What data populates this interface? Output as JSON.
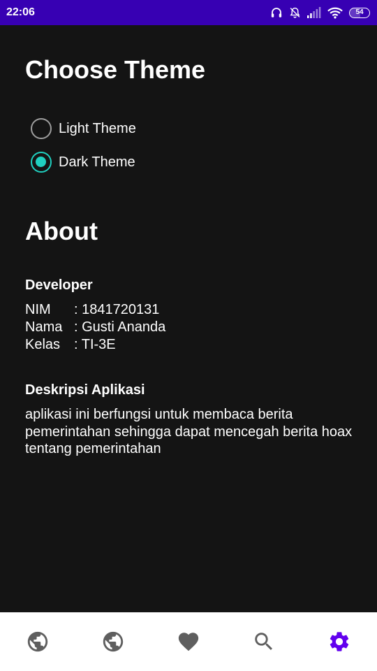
{
  "status_bar": {
    "time": "22:06",
    "battery": "54",
    "background": "#3700b3",
    "icons": [
      "headphones-icon",
      "bell-off-icon",
      "signal-icon",
      "wifi-icon",
      "battery-icon"
    ]
  },
  "theme_section": {
    "title": "Choose Theme",
    "options": [
      {
        "label": "Light Theme",
        "checked": false
      },
      {
        "label": "Dark Theme",
        "checked": true
      }
    ],
    "accent": "#20d0c0"
  },
  "about": {
    "title": "About",
    "developer": {
      "heading": "Developer",
      "rows": [
        {
          "key": "NIM",
          "value": ": 1841720131"
        },
        {
          "key": "Nama",
          "value": ": Gusti Ananda"
        },
        {
          "key": "Kelas",
          "value": ": TI-3E"
        }
      ]
    },
    "description": {
      "heading": "Deskripsi Aplikasi",
      "text": "aplikasi ini berfungsi untuk membaca berita pemerintahan sehingga dapat mencegah berita hoax tentang pemerintahan"
    }
  },
  "bottom_nav": {
    "items": [
      {
        "icon": "globe-icon",
        "active": false
      },
      {
        "icon": "globe-icon",
        "active": false
      },
      {
        "icon": "heart-icon",
        "active": false
      },
      {
        "icon": "search-icon",
        "active": false
      },
      {
        "icon": "settings-gear-icon",
        "active": true
      }
    ],
    "active_color": "#6200ee",
    "inactive_color": "#5f5f5f"
  }
}
